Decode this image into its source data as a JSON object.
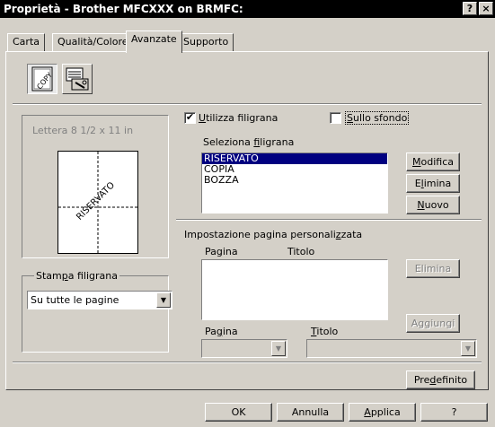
{
  "window": {
    "title": "Proprietà - Brother MFCXXX on BRMFC:",
    "help_btn": "?",
    "close_btn": "×"
  },
  "tabs": [
    {
      "label": "Carta"
    },
    {
      "label": "Qualità/Colore"
    },
    {
      "label": "Avanzate"
    },
    {
      "label": "Supporto"
    }
  ],
  "preview": {
    "paper_size": "Lettera 8 1/2 x 11 in",
    "watermark_text": "RISERVATO"
  },
  "stampa": {
    "group_label": "Stampa filigrana",
    "selected": "Su tutte le pagine"
  },
  "watermark": {
    "use_label": "Utilizza filigrana",
    "use_checked": "✔",
    "background_label": "Sullo sfondo",
    "select_label": "Seleziona filigrana",
    "items": [
      "RISERVATO",
      "COPIA",
      "BOZZA"
    ],
    "modify_btn": "Modifica",
    "delete_btn": "Elimina",
    "new_btn": "Nuovo"
  },
  "custom": {
    "section_label": "Impostazione pagina personalizzata",
    "col_page": "Pagina",
    "col_title": "Titolo",
    "delete_btn": "Elimina",
    "add_btn": "Aggiungi",
    "page_label": "Pagina",
    "title_label": "Titolo"
  },
  "footer": {
    "default_btn": "Predefinito",
    "ok_btn": "OK",
    "cancel_btn": "Annulla",
    "apply_btn": "Applica",
    "help_btn": "?"
  }
}
